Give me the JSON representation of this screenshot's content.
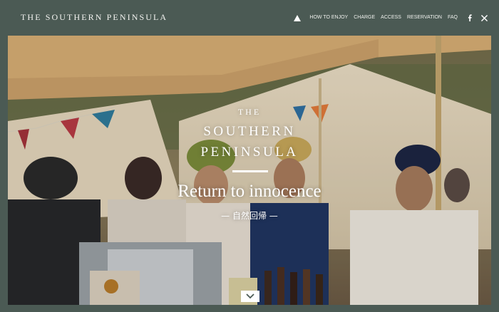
{
  "header": {
    "brand": "THE SOUTHERN PENINSULA",
    "nav": [
      "HOW TO ENJOY",
      "CHARGE",
      "ACCESS",
      "RESERVATION",
      "FAQ"
    ],
    "icons": [
      "home-icon",
      "facebook-icon",
      "x-icon"
    ]
  },
  "hero": {
    "logo_line1": "THE",
    "logo_line2": "SOUTHERN",
    "logo_line3": "PENINSULA",
    "tagline": "Return to innocence",
    "subline": "— 自然回帰 —",
    "scroll_icon": "chevron-down-icon"
  },
  "colors": {
    "header_bg": "#4b5a54",
    "text": "#ffffff"
  }
}
